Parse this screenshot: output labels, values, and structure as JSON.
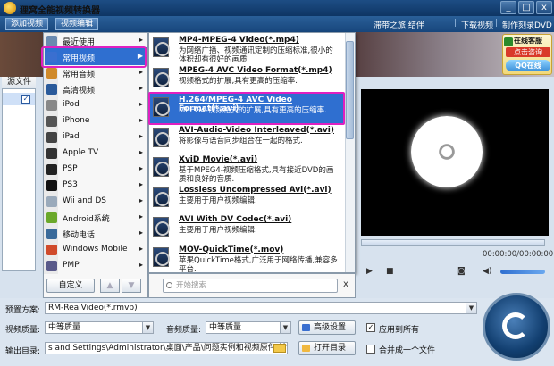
{
  "window": {
    "title": "狸窝全能视频转换器",
    "buttons": [
      "_",
      "□",
      "x"
    ]
  },
  "toolbar": {
    "add_video": "添加视频",
    "edit_video": "视频编辑",
    "links": [
      "滞带之旅 结伴",
      "下载视频",
      "制作刻录DVD"
    ],
    "separator": "|"
  },
  "promo": {
    "line1": "在线客服",
    "line2": "点击咨询",
    "line3": "QQ在线"
  },
  "file_panel": {
    "header": "源文件"
  },
  "categories": [
    {
      "label": "最近使用",
      "icon": "clock-icon",
      "color": "#6a8ab0",
      "arrow": "▸"
    },
    {
      "label": "常用视频",
      "icon": "film-icon",
      "color": "#3a6fd0",
      "arrow": "▶"
    },
    {
      "label": "常用音频",
      "icon": "music-icon",
      "color": "#d08a2a",
      "arrow": "▸"
    },
    {
      "label": "高清视频",
      "icon": "hd-icon",
      "color": "#2a5a9a",
      "arrow": "▸"
    },
    {
      "label": "iPod",
      "icon": "ipod-icon",
      "color": "#888888",
      "arrow": "▸"
    },
    {
      "label": "iPhone",
      "icon": "iphone-icon",
      "color": "#555555",
      "arrow": "▸"
    },
    {
      "label": "iPad",
      "icon": "ipad-icon",
      "color": "#444444",
      "arrow": "▸"
    },
    {
      "label": "Apple TV",
      "icon": "apple-tv-icon",
      "color": "#333333",
      "arrow": "▸"
    },
    {
      "label": "PSP",
      "icon": "psp-icon",
      "color": "#222222",
      "arrow": "▸"
    },
    {
      "label": "PS3",
      "icon": "ps3-icon",
      "color": "#111111",
      "arrow": "▸"
    },
    {
      "label": "Wii and DS",
      "icon": "wii-icon",
      "color": "#9aaabb",
      "arrow": "▸"
    },
    {
      "label": "Android系统",
      "icon": "android-icon",
      "color": "#6aa82a",
      "arrow": "▸"
    },
    {
      "label": "移动电话",
      "icon": "phone-icon",
      "color": "#3a6a9a",
      "arrow": "▸"
    },
    {
      "label": "Windows Mobile",
      "icon": "windows-icon",
      "color": "#d04a2a",
      "arrow": "▸"
    },
    {
      "label": "PMP",
      "icon": "pmp-icon",
      "color": "#5a5a8a",
      "arrow": "▸"
    }
  ],
  "formats": [
    {
      "title": "MP4-MPEG-4 Video(*.mp4)",
      "desc": "为网络广播、视频通讯定制的压缩标准,很小的体积却有很好的画质"
    },
    {
      "title": "MPEG-4 AVC Video Format(*.mp4)",
      "desc": "视频格式的扩展,具有更高的压缩率."
    },
    {
      "title": "H.264/MPEG-4 AVC Video Format(*.avi)",
      "desc": "MPEG4-视频格式的扩展,具有更高的压缩率."
    },
    {
      "title": "AVI-Audio-Video Interleaved(*.avi)",
      "desc": "将影像与语音同步组合在一起的格式."
    },
    {
      "title": "XviD Movie(*.avi)",
      "desc": "基于MPEG4-视频压缩格式,具有接近DVD的画质和良好的音质."
    },
    {
      "title": "Lossless Uncompressed Avi(*.avi)",
      "desc": "主要用于用户视频编辑."
    },
    {
      "title": "AVI With DV Codec(*.avi)",
      "desc": "主要用于用户视频编辑."
    },
    {
      "title": "MOV-QuickTime(*.mov)",
      "desc": "苹果QuickTime格式,广泛用于网络传播,兼容多平台."
    }
  ],
  "dropdown_footer": {
    "customize": "自定义",
    "up": "▲",
    "down": "▼",
    "search_placeholder": "开始搜索",
    "close": "x"
  },
  "player": {
    "timecode": "00:00:00/00:00:00",
    "play": "▶",
    "stop": "■",
    "camera": "◙",
    "volume_icon": "◀)"
  },
  "settings": {
    "preset_label": "预置方案:",
    "preset_value": "RM-RealVideo(*.rmvb)",
    "video_quality_label": "视频质量:",
    "video_quality_value": "中等质量",
    "audio_quality_label": "音频质量:",
    "audio_quality_value": "中等质量",
    "advanced_button": "高级设置",
    "apply_all_label": "应用到所有",
    "apply_all_checked": true,
    "output_label": "输出目录:",
    "output_path": "s and Settings\\Administrator\\桌面\\产品\\问题实例和视频原件\\转换",
    "open_dir_button": "打开目录",
    "merge_label": "合并成一个文件",
    "merge_checked": false
  },
  "colors": {
    "selection_blue": "#2f6fd0",
    "highlight_magenta": "#e020c0",
    "titlebar": "#1d4d84"
  }
}
